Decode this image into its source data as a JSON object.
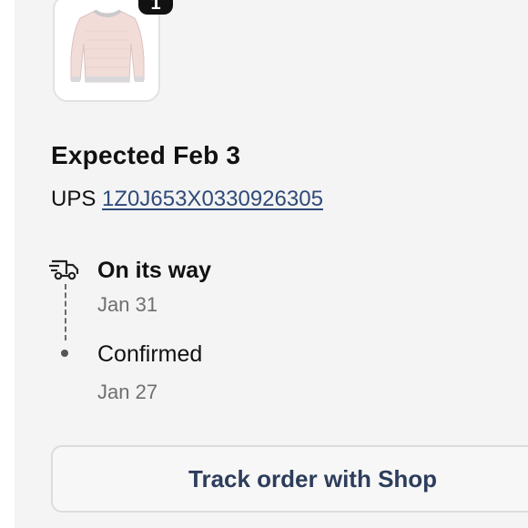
{
  "order": {
    "quantity": "1",
    "product_image": "sweater-image"
  },
  "shipment": {
    "expected": "Expected Feb 3",
    "carrier": "UPS",
    "tracking_number": "1Z0J653X0330926305"
  },
  "timeline": {
    "events": [
      {
        "title": "On its way",
        "date": "Jan 31",
        "icon": "delivery-truck-icon"
      },
      {
        "title": "Confirmed",
        "date": "Jan 27",
        "icon": "dot"
      }
    ]
  },
  "actions": {
    "track_label": "Track order with Shop"
  },
  "colors": {
    "link": "#2e4a78",
    "button_text": "#2d3d5c",
    "muted_text": "#6f6f6f"
  }
}
